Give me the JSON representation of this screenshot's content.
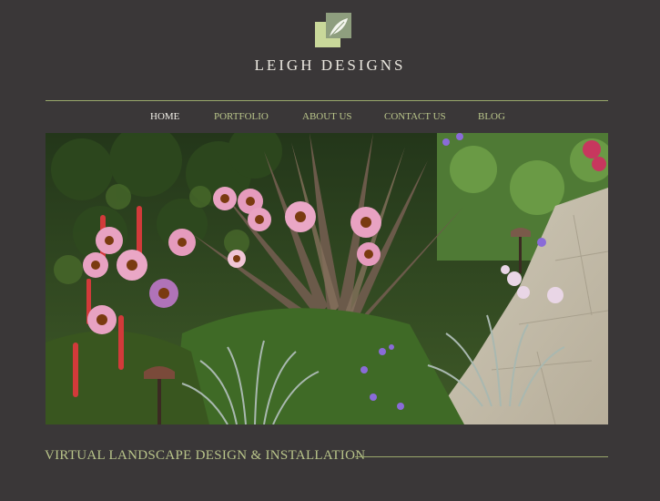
{
  "brand": {
    "name": "LEIGH DESIGNS"
  },
  "nav": {
    "items": [
      {
        "label": "HOME",
        "active": true
      },
      {
        "label": "PORTFOLIO",
        "active": false
      },
      {
        "label": "ABOUT US",
        "active": false
      },
      {
        "label": "CONTACT US",
        "active": false
      },
      {
        "label": "BLOG",
        "active": false
      }
    ]
  },
  "tagline": "VIRTUAL LANDSCAPE DESIGN & INSTALLATION",
  "colors": {
    "background": "#3a3738",
    "accent": "#b9c58a",
    "nav_active": "#f2f0e9",
    "logo_light": "#c9d89a",
    "logo_dark": "#8e9e7e"
  },
  "hero_image": {
    "icon": "garden-photo"
  }
}
